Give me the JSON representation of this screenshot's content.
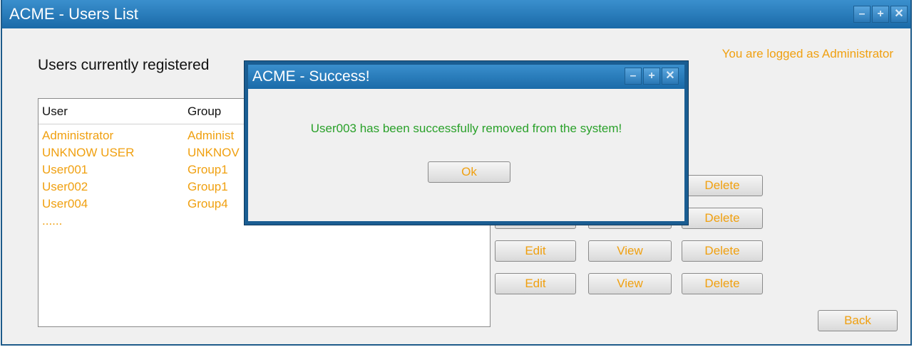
{
  "window": {
    "title": "ACME - Users List"
  },
  "header": {
    "logged_text": "You are logged as Administrator",
    "page_title": "Users currently registered"
  },
  "table": {
    "columns": [
      "User",
      "Group"
    ],
    "rows": [
      {
        "user": "Administrator",
        "group": "Administ"
      },
      {
        "user": "UNKNOW USER",
        "group": "UNKNOV"
      },
      {
        "user": "User001",
        "group": "Group1"
      },
      {
        "user": "User002",
        "group": "Group1"
      },
      {
        "user": "User004",
        "group": "Group4"
      },
      {
        "user": "......",
        "group": ""
      }
    ]
  },
  "actions": {
    "edit": "Edit",
    "view": "View",
    "delete": "Delete",
    "back": "Back"
  },
  "dialog": {
    "title": "ACME - Success!",
    "message": "User003 has been successfully removed from the system!",
    "ok": "Ok"
  },
  "colors": {
    "accent": "#f0a010",
    "success": "#2aa12a",
    "titlebar": "#1a6aa8"
  }
}
